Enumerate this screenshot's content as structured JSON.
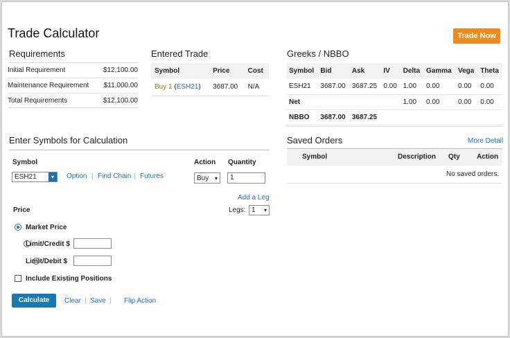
{
  "page": {
    "title": "Trade Calculator",
    "trade_now_label": "Trade Now"
  },
  "requirements": {
    "heading": "Requirements",
    "rows": [
      {
        "label": "Initial Requirement",
        "value": "$12,100.00"
      },
      {
        "label": "Maintenance Requirement",
        "value": "$11,000.00"
      },
      {
        "label": "Total Requirements",
        "value": "$12,100.00"
      }
    ]
  },
  "entered_trade": {
    "heading": "Entered Trade",
    "columns": [
      "Symbol",
      "Price",
      "Cost"
    ],
    "row": {
      "action": "Buy 1",
      "open_paren": "(",
      "symbol": "ESH21",
      "close_paren": ")",
      "price": "3687.00",
      "cost": "N/A"
    }
  },
  "greeks": {
    "heading": "Greeks / NBBO",
    "columns": [
      "Symbol",
      "Bid",
      "Ask",
      "IV",
      "Delta",
      "Gamma",
      "Vega",
      "Theta"
    ],
    "rows": [
      [
        "ESH21",
        "3687.00",
        "3687.25",
        "0.00",
        "1.00",
        "0.00",
        "0.00",
        "0.00"
      ],
      [
        "Net",
        "",
        "",
        "",
        "1.00",
        "0.00",
        "0.00",
        "0.00"
      ],
      [
        "NBBO",
        "3687.00",
        "3687.25",
        "",
        "",
        "",
        "",
        ""
      ]
    ]
  },
  "calc": {
    "heading": "Enter Symbols for Calculation",
    "symbol_header": "Symbol",
    "action_header": "Action",
    "quantity_header": "Quantity",
    "symbol_value": "ESH21",
    "option_link": "Option",
    "find_chain_link": "Find Chain",
    "futures_link": "Futures",
    "action_value": "Buy",
    "quantity_value": "1",
    "add_leg": "Add a Leg",
    "legs_label": "Legs:",
    "legs_value": "1",
    "price_label": "Price",
    "market_price": "Market Price",
    "limit_credit": "Limit/Credit $",
    "limit_debit": "Limit/Debit $",
    "include_existing": "Include Existing Positions",
    "calculate": "Calculate",
    "clear": "Clear",
    "save": "Save",
    "flip_action": "Flip Action",
    "separator": "|"
  },
  "saved_orders": {
    "heading": "Saved Orders",
    "more_detail": "More Detail",
    "columns": [
      "Symbol",
      "Description",
      "Qty",
      "Action"
    ],
    "empty": "No saved orders."
  },
  "colors": {
    "accent_orange": "#f08a1d",
    "link_blue": "#1a6fb5",
    "button_blue": "#1a7ab0"
  }
}
